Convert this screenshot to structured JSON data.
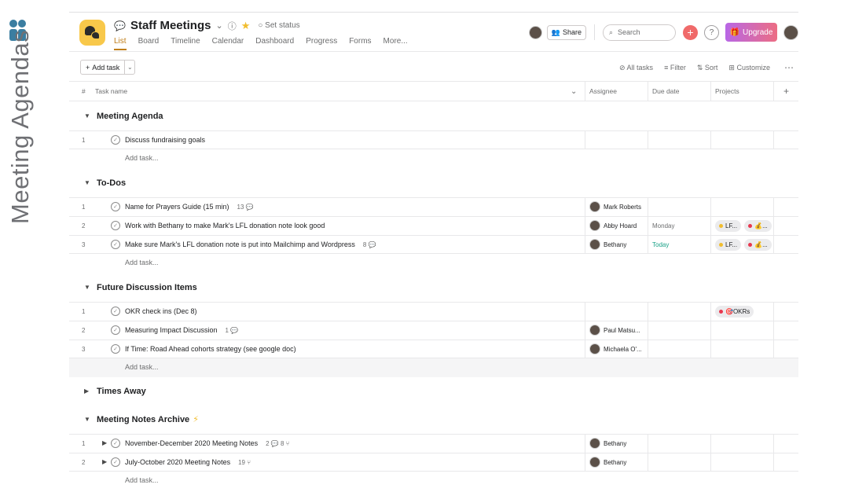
{
  "side": {
    "title": "Meeting Agendas"
  },
  "header": {
    "title": "Staff Meetings",
    "set_status": "Set status",
    "tabs": [
      "List",
      "Board",
      "Timeline",
      "Calendar",
      "Dashboard",
      "Progress",
      "Forms",
      "More..."
    ],
    "share_label": "Share",
    "search_placeholder": "Search",
    "upgrade_label": "Upgrade"
  },
  "toolbar": {
    "add_task_label": "Add task",
    "all_tasks_label": "All tasks",
    "filter_label": "Filter",
    "sort_label": "Sort",
    "customize_label": "Customize"
  },
  "columns": {
    "num": "#",
    "task": "Task name",
    "assignee": "Assignee",
    "due": "Due date",
    "projects": "Projects"
  },
  "add_task_inline": "Add task...",
  "sections": [
    {
      "name": "Meeting Agenda",
      "tasks": [
        {
          "num": "1",
          "name": "Discuss fundraising goals",
          "meta": "",
          "assignee": "",
          "due": "",
          "projects": []
        }
      ]
    },
    {
      "name": "To-Dos",
      "tasks": [
        {
          "num": "1",
          "name": "Name for Prayers Guide (15 min)",
          "meta": "13 💬",
          "assignee": "Mark Roberts",
          "due": "",
          "projects": []
        },
        {
          "num": "2",
          "name": "Work with Bethany to make Mark's LFL donation note look good",
          "meta": "",
          "assignee": "Abby Hoard",
          "due": "Monday",
          "projects": [
            "LF...",
            "💰..."
          ]
        },
        {
          "num": "3",
          "name": "Make sure Mark's LFL donation note is put into Mailchimp and Wordpress",
          "meta": "8 💬",
          "assignee": "Bethany",
          "due": "Today",
          "projects": [
            "LF...",
            "💰..."
          ]
        }
      ]
    },
    {
      "name": "Future Discussion Items",
      "tasks": [
        {
          "num": "1",
          "name": "OKR check ins (Dec 8)",
          "meta": "",
          "assignee": "",
          "due": "",
          "projects": [
            "🎯OKRs"
          ]
        },
        {
          "num": "2",
          "name": "Measuring Impact Discussion",
          "meta": "1 💬",
          "assignee": "Paul Matsu...",
          "due": "",
          "projects": []
        },
        {
          "num": "3",
          "name": "If Time: Road Ahead cohorts strategy (see google doc)",
          "meta": "",
          "assignee": "Michaela O'...",
          "due": "",
          "projects": []
        }
      ]
    },
    {
      "name": "Times Away",
      "tasks": []
    },
    {
      "name": "Meeting Notes Archive",
      "tasks": [
        {
          "num": "1",
          "name": "November-December 2020 Meeting Notes",
          "meta": "2 💬  8 ⑂",
          "assignee": "Bethany",
          "due": "",
          "projects": []
        },
        {
          "num": "2",
          "name": "July-October 2020 Meeting Notes",
          "meta": "19 ⑂",
          "assignee": "Bethany",
          "due": "",
          "projects": []
        }
      ]
    }
  ],
  "colors": {
    "accent": "#bf7e1a",
    "today": "#19a187",
    "project_yellow": "#f1bd2e",
    "project_red": "#e8384f",
    "project_icon": "#f8c84a"
  }
}
